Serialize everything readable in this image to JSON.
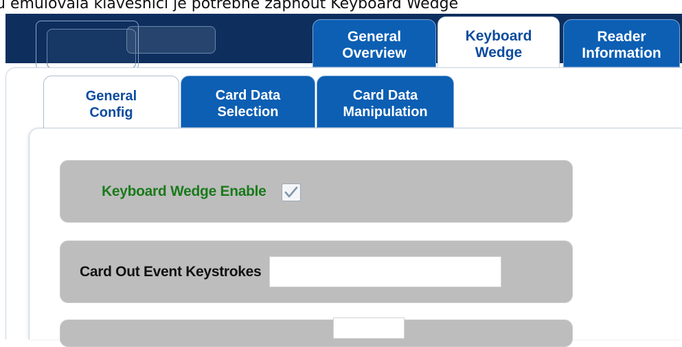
{
  "caption": "u emulovala klávesnici je potřebné zapnout Keyboard Wedge",
  "top_tabs": [
    {
      "line1": "General",
      "line2": "Overview",
      "active": false
    },
    {
      "line1": "Keyboard",
      "line2": "Wedge",
      "active": true
    },
    {
      "line1": "Reader",
      "line2": "Information",
      "active": false
    }
  ],
  "sub_tabs": [
    {
      "line1": "General",
      "line2": "Config",
      "active": true
    },
    {
      "line1": "Card Data",
      "line2": "Selection",
      "active": false
    },
    {
      "line1": "Card Data",
      "line2": "Manipulation",
      "active": false
    }
  ],
  "settings": {
    "keyboard_wedge_enable": {
      "label": "Keyboard Wedge Enable",
      "checked": true
    },
    "card_out_event_keystrokes": {
      "label": "Card Out Event Keystrokes",
      "value": ""
    }
  },
  "colors": {
    "header": "#0e2f5e",
    "tab_blue": "#0c5fb3",
    "active_tab_text": "#0c4c9e",
    "row_gray": "#bdbdbd",
    "green_label": "#1a7a1a"
  }
}
